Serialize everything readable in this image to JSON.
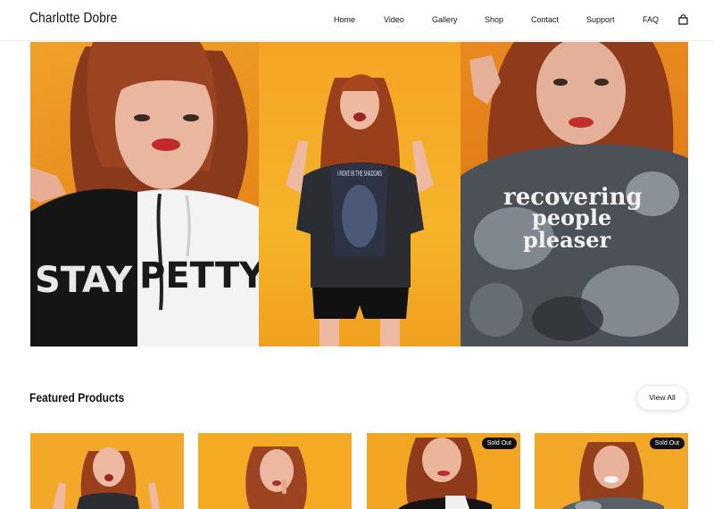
{
  "brand": {
    "name": "Charlotte Dobre"
  },
  "nav": {
    "items": [
      {
        "label": "Home",
        "name": "nav-home"
      },
      {
        "label": "Video",
        "name": "nav-video"
      },
      {
        "label": "Gallery",
        "name": "nav-gallery"
      },
      {
        "label": "Shop",
        "name": "nav-shop"
      },
      {
        "label": "Contact",
        "name": "nav-contact"
      },
      {
        "label": "Support",
        "name": "nav-support"
      },
      {
        "label": "FAQ",
        "name": "nav-faq"
      }
    ],
    "cart_icon": "shopping-bag-icon"
  },
  "hero": {
    "panels": [
      {
        "name": "hero-panel-stay-petty",
        "shirt_text_left": "STAY",
        "shirt_text_right": "PETTY"
      },
      {
        "name": "hero-panel-shadows",
        "shirt_text": "I MOVE IN THE SHADOWS"
      },
      {
        "name": "hero-panel-recovering",
        "shirt_text_lines": [
          "recovering",
          "people",
          "pleaser"
        ]
      }
    ]
  },
  "featured": {
    "title": "Featured Products",
    "view_all_label": "View All",
    "products": [
      {
        "name": "product-card-1",
        "sold_out": false,
        "badge": ""
      },
      {
        "name": "product-card-2",
        "sold_out": false,
        "badge": ""
      },
      {
        "name": "product-card-3",
        "sold_out": true,
        "badge": "Sold Out"
      },
      {
        "name": "product-card-4",
        "sold_out": true,
        "badge": "Sold Out"
      }
    ]
  },
  "colors": {
    "accent_orange": "#f0a12a",
    "text": "#111111",
    "badge_bg": "#111111"
  }
}
